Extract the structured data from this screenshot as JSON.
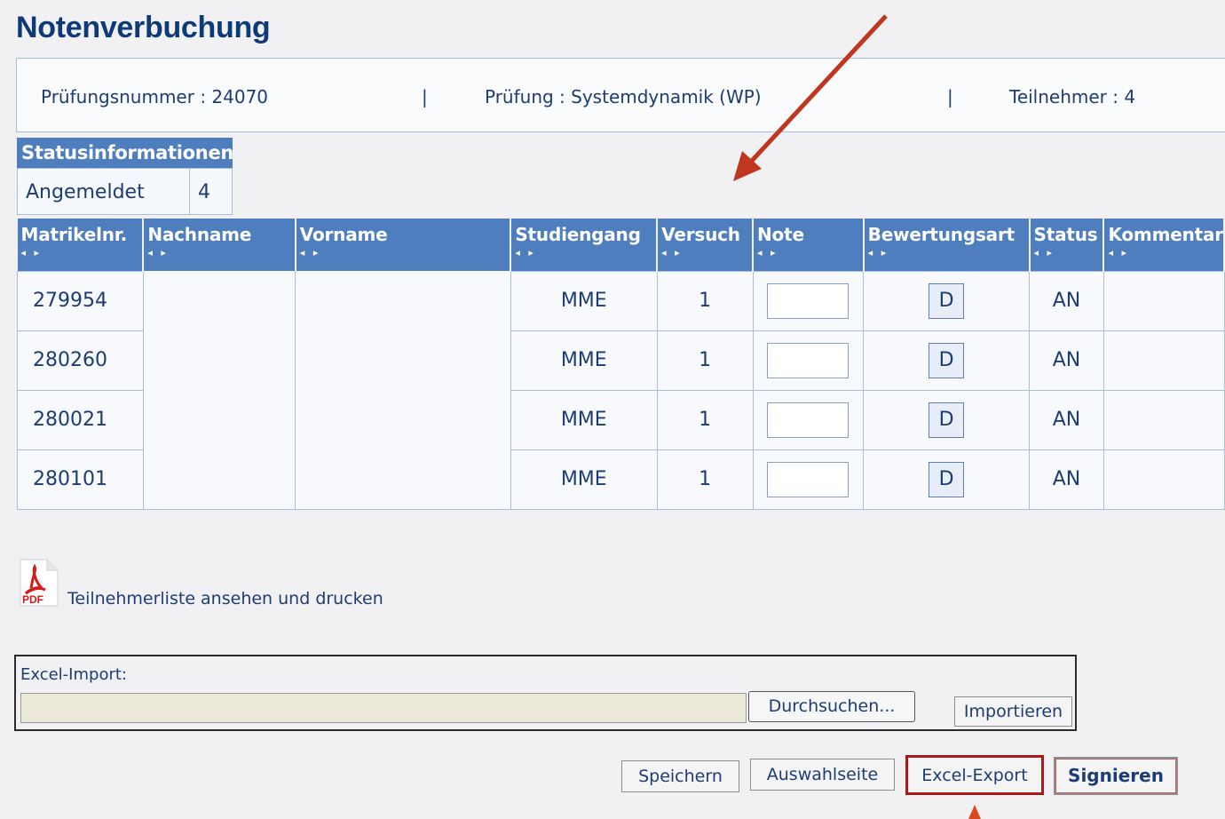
{
  "page_title": "Notenverbuchung",
  "exam_info": {
    "number": "Prüfungsnummer :  24070",
    "sep": "|",
    "exam": "Prüfung :  Systemdynamik (WP)",
    "participants": "Teilnehmer :  4"
  },
  "status_info": {
    "heading": "Statusinformationen",
    "label": "Angemeldet",
    "count": "4"
  },
  "table": {
    "sort_arrows": "◂ ▸",
    "headers": {
      "matrikel": "Matrikelnr.",
      "nachname": "Nachname",
      "vorname": "Vorname",
      "studiengang": "Studiengang",
      "versuch": "Versuch",
      "note": "Note",
      "bewertungsart": "Bewertungsart",
      "status": "Status",
      "kommentar": "Kommentar"
    },
    "rows": [
      {
        "matrikel": "279954",
        "studiengang": "MME",
        "versuch": "1",
        "bewertung": "D",
        "status": "AN"
      },
      {
        "matrikel": "280260",
        "studiengang": "MME",
        "versuch": "1",
        "bewertung": "D",
        "status": "AN"
      },
      {
        "matrikel": "280021",
        "studiengang": "MME",
        "versuch": "1",
        "bewertung": "D",
        "status": "AN"
      },
      {
        "matrikel": "280101",
        "studiengang": "MME",
        "versuch": "1",
        "bewertung": "D",
        "status": "AN"
      }
    ]
  },
  "pdf": {
    "icon_text": "PDF",
    "link": "Teilnehmerliste ansehen und drucken"
  },
  "excel_import": {
    "label": "Excel-Import:",
    "browse": "Durchsuchen...",
    "import": "Importieren"
  },
  "actions": {
    "save": "Speichern",
    "selection": "Auswahlseite",
    "export": "Excel-Export",
    "sign": "Signieren"
  },
  "colors": {
    "header_blue": "#4f7ebe",
    "annotation_arrow": "#c0361e",
    "highlight_border": "#b01818"
  }
}
